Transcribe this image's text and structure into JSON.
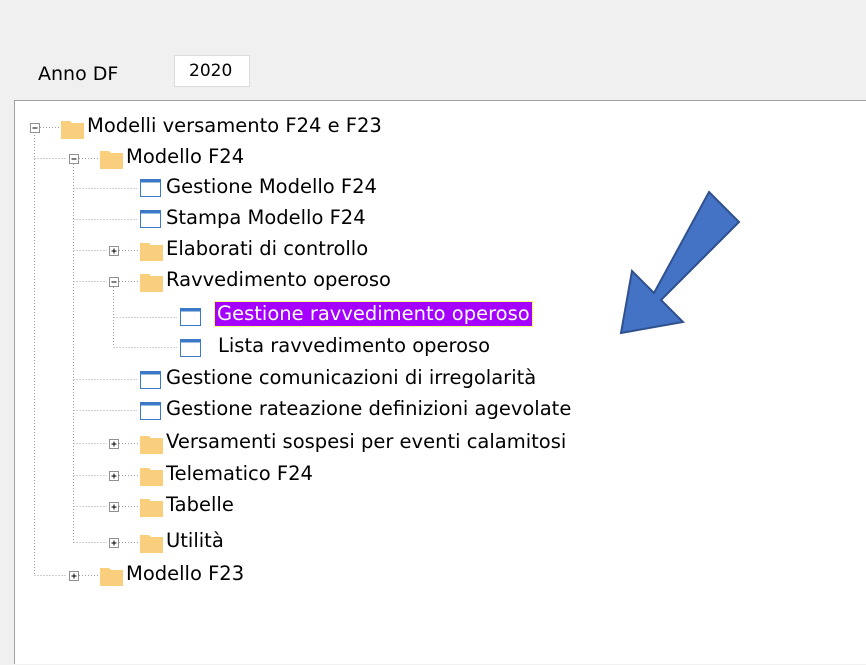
{
  "header": {
    "anno_label": "Anno DF",
    "anno_value": "2020"
  },
  "tree": {
    "nodes": [
      {
        "label": "Modelli versamento F24 e F23",
        "type": "folder",
        "expander": "minus"
      },
      {
        "label": "Modello F24",
        "type": "folder",
        "expander": "minus"
      },
      {
        "label": "Gestione Modello F24",
        "type": "form"
      },
      {
        "label": "Stampa Modello F24",
        "type": "form"
      },
      {
        "label": "Elaborati di controllo",
        "type": "folder",
        "expander": "plus"
      },
      {
        "label": "Ravvedimento operoso",
        "type": "folder",
        "expander": "minus"
      },
      {
        "label": "Gestione ravvedimento operoso",
        "type": "form",
        "selected": true
      },
      {
        "label": "Lista ravvedimento operoso",
        "type": "form"
      },
      {
        "label": "Gestione comunicazioni di irregolarità",
        "type": "form"
      },
      {
        "label": "Gestione rateazione definizioni agevolate",
        "type": "form"
      },
      {
        "label": "Versamenti sospesi per eventi calamitosi",
        "type": "folder",
        "expander": "plus"
      },
      {
        "label": "Telematico F24",
        "type": "folder",
        "expander": "plus"
      },
      {
        "label": "Tabelle",
        "type": "folder",
        "expander": "plus"
      },
      {
        "label": "Utilità",
        "type": "folder",
        "expander": "plus"
      },
      {
        "label": "Modello F23",
        "type": "folder",
        "expander": "plus"
      }
    ]
  },
  "colors": {
    "folder": "#f9cf7e",
    "selection": "#a500ff",
    "arrow_fill": "#4472c4",
    "arrow_stroke": "#2f528f",
    "form_icon_header": "#3c78c8"
  }
}
